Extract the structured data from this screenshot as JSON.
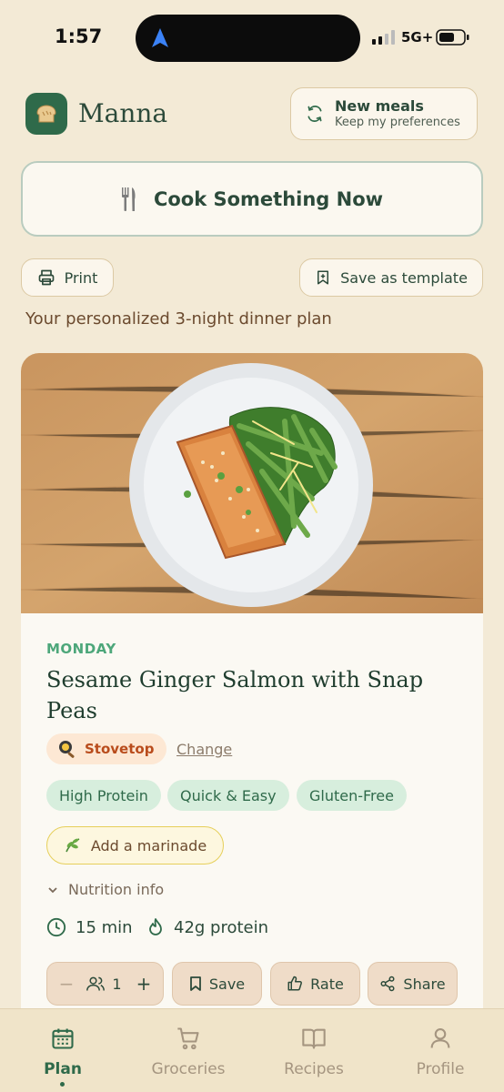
{
  "status_bar": {
    "time": "1:57",
    "network": "5G+"
  },
  "header": {
    "app_name": "Manna",
    "new_meals": {
      "title": "New meals",
      "subtitle": "Keep my preferences"
    }
  },
  "cook_button": {
    "label": "Cook Something Now"
  },
  "actions": {
    "print_label": "Print",
    "save_template_label": "Save as template"
  },
  "plan_subtitle": "Your personalized 3-night dinner plan",
  "meal": {
    "day": "MONDAY",
    "title": "Sesame Ginger Salmon with Snap Peas",
    "method": "Stovetop",
    "change_label": "Change",
    "tags": [
      "High Protein",
      "Quick & Easy",
      "Gluten-Free"
    ],
    "marinade_label": "Add a marinade",
    "nutrition_label": "Nutrition info",
    "time": "15 min",
    "protein": "42g protein",
    "servings": "1",
    "save_label": "Save",
    "rate_label": "Rate",
    "share_label": "Share"
  },
  "tabs": [
    {
      "label": "Plan",
      "icon": "calendar-icon",
      "active": true
    },
    {
      "label": "Groceries",
      "icon": "cart-icon",
      "active": false
    },
    {
      "label": "Recipes",
      "icon": "book-icon",
      "active": false
    },
    {
      "label": "Profile",
      "icon": "person-icon",
      "active": false
    }
  ],
  "colors": {
    "background": "#f3ead6",
    "brand": "#2f6a4a",
    "accent_green": "#4da77a",
    "stovetop": "#b94c1c"
  }
}
